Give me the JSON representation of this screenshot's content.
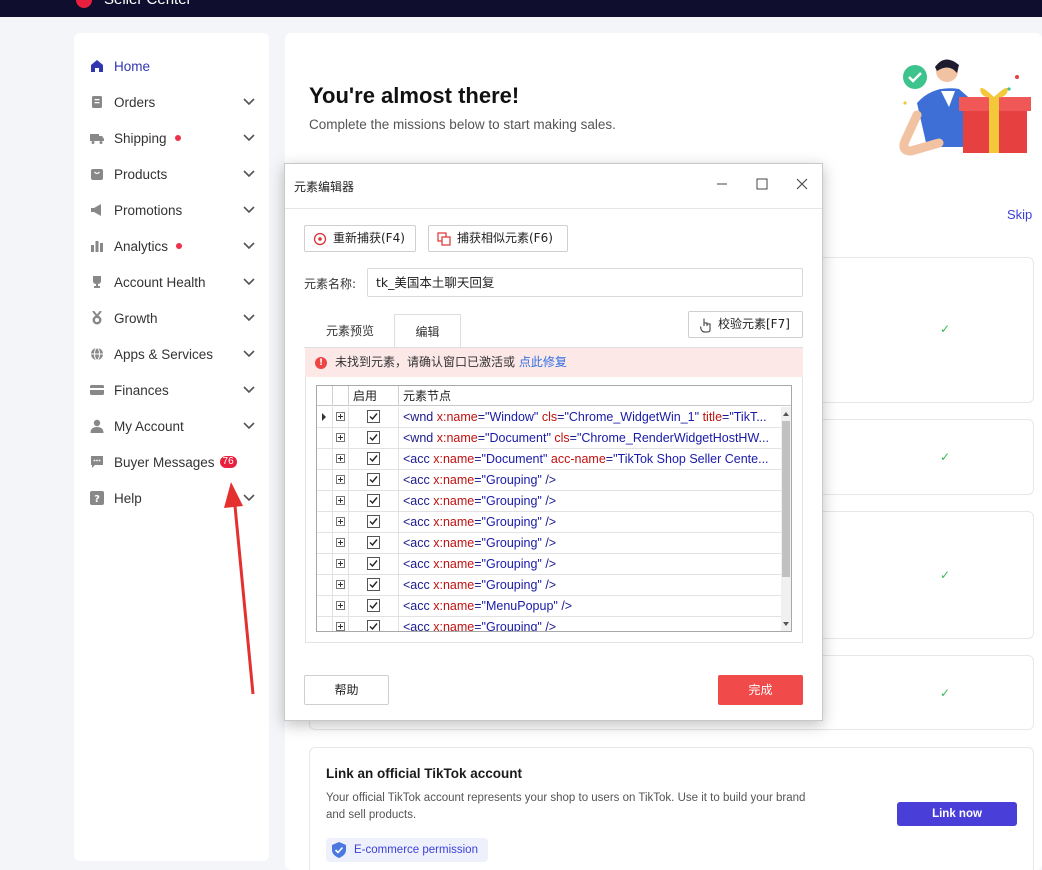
{
  "topbar": {
    "brand": "Seller Center"
  },
  "sidebar": {
    "items": [
      {
        "label": "Home",
        "icon": "home-icon",
        "active": true
      },
      {
        "label": "Orders",
        "icon": "orders-icon"
      },
      {
        "label": "Shipping",
        "icon": "truck-icon",
        "dot": true
      },
      {
        "label": "Products",
        "icon": "bag-icon"
      },
      {
        "label": "Promotions",
        "icon": "megaphone-icon"
      },
      {
        "label": "Analytics",
        "icon": "bar-chart-icon",
        "dot": true
      },
      {
        "label": "Account Health",
        "icon": "trophy-icon"
      },
      {
        "label": "Growth",
        "icon": "medal-icon"
      },
      {
        "label": "Apps & Services",
        "icon": "globe-icon"
      },
      {
        "label": "Finances",
        "icon": "card-icon"
      },
      {
        "label": "My Account",
        "icon": "user-icon"
      },
      {
        "label": "Buyer Messages",
        "icon": "chat-icon",
        "badge": "76"
      },
      {
        "label": "Help",
        "icon": "question-icon"
      }
    ]
  },
  "main": {
    "title": "You're almost there!",
    "subtitle": "Complete the missions below to start making sales.",
    "skip": "Skip",
    "link_card": {
      "title": "Link an official TikTok account",
      "desc": "Your official TikTok account represents your shop to users on TikTok. Use it to build your brand and sell products.",
      "permission": "E-commerce permission",
      "button": "Link now"
    }
  },
  "dialog": {
    "title": "元素编辑器",
    "recapture": "重新捕获(F4)",
    "capture_similar": "捕获相似元素(F6)",
    "name_label": "元素名称:",
    "name_value": "tk_美国本土聊天回复",
    "tab_preview": "元素预览",
    "tab_edit": "编辑",
    "verify": "校验元素[F7]",
    "error_text": "未找到元素，请确认窗口已激活或",
    "error_link": "点此修复",
    "col_enabled": "启用",
    "col_node": "元素节点",
    "rows": [
      {
        "tag": "<wnd ",
        "a1": "x:name",
        "v1": "\"Window\"",
        "a2": "cls",
        "v2": "\"Chrome_WidgetWin_1\"",
        "a3": "title",
        "v3": "\"TikT...",
        "end": ""
      },
      {
        "tag": "<wnd ",
        "a1": "x:name",
        "v1": "\"Document\"",
        "a2": "cls",
        "v2": "\"Chrome_RenderWidgetHostHW...",
        "a3": "",
        "v3": "",
        "end": ""
      },
      {
        "tag": "<acc ",
        "a1": "x:name",
        "v1": "\"Document\"",
        "a2": "acc-name",
        "v2": "\"TikTok Shop Seller Cente...",
        "a3": "",
        "v3": "",
        "end": ""
      },
      {
        "tag": "<acc ",
        "a1": "x:name",
        "v1": "\"Grouping\"",
        "a2": "",
        "v2": "",
        "a3": "",
        "v3": "",
        "end": " />"
      },
      {
        "tag": "<acc ",
        "a1": "x:name",
        "v1": "\"Grouping\"",
        "a2": "",
        "v2": "",
        "a3": "",
        "v3": "",
        "end": " />"
      },
      {
        "tag": "<acc ",
        "a1": "x:name",
        "v1": "\"Grouping\"",
        "a2": "",
        "v2": "",
        "a3": "",
        "v3": "",
        "end": " />"
      },
      {
        "tag": "<acc ",
        "a1": "x:name",
        "v1": "\"Grouping\"",
        "a2": "",
        "v2": "",
        "a3": "",
        "v3": "",
        "end": " />"
      },
      {
        "tag": "<acc ",
        "a1": "x:name",
        "v1": "\"Grouping\"",
        "a2": "",
        "v2": "",
        "a3": "",
        "v3": "",
        "end": " />"
      },
      {
        "tag": "<acc ",
        "a1": "x:name",
        "v1": "\"Grouping\"",
        "a2": "",
        "v2": "",
        "a3": "",
        "v3": "",
        "end": " />"
      },
      {
        "tag": "<acc ",
        "a1": "x:name",
        "v1": "\"MenuPopup\"",
        "a2": "",
        "v2": "",
        "a3": "",
        "v3": "",
        "end": " />"
      },
      {
        "tag": "<acc ",
        "a1": "x:name",
        "v1": "\"Grouping\"",
        "a2": "",
        "v2": "",
        "a3": "",
        "v3": "",
        "end": " />"
      }
    ],
    "help": "帮助",
    "done": "完成"
  },
  "colors": {
    "accent": "#4a3ed9",
    "danger": "#f04a4a",
    "sidebar_active": "#3235b0"
  }
}
